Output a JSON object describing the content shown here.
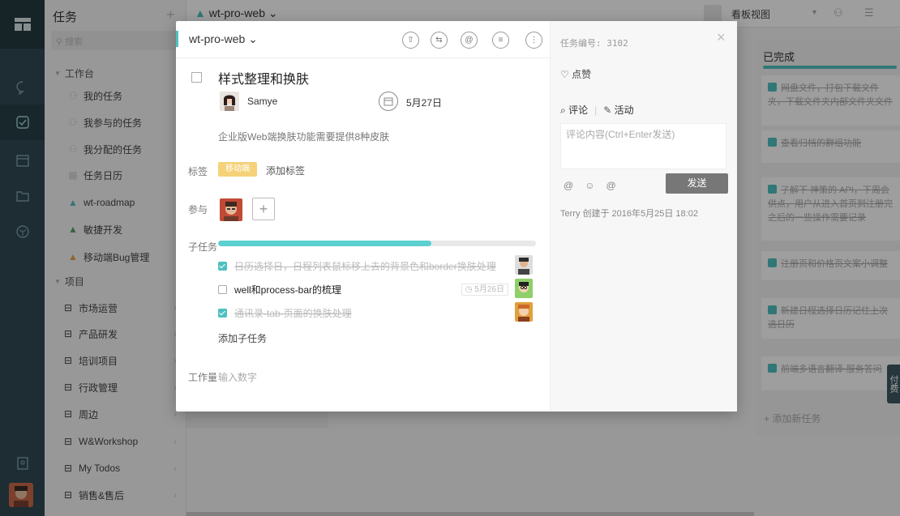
{
  "app": {
    "sidebar": {
      "title": "任务",
      "search_placeholder": "搜索",
      "groups": [
        {
          "label": "工作台"
        },
        {
          "label": "项目"
        }
      ],
      "workbench_items": [
        {
          "label": "我的任务"
        },
        {
          "label": "我参与的任务"
        },
        {
          "label": "我分配的任务"
        },
        {
          "label": "任务日历"
        },
        {
          "label": "wt-roadmap"
        },
        {
          "label": "敏捷开发"
        },
        {
          "label": "移动端Bug管理"
        }
      ],
      "project_items": [
        {
          "label": "市场运营"
        },
        {
          "label": "产品研发"
        },
        {
          "label": "培训项目"
        },
        {
          "label": "行政管理"
        },
        {
          "label": "周边"
        },
        {
          "label": "W&Workshop"
        },
        {
          "label": "My Todos"
        },
        {
          "label": "销售&售后"
        }
      ]
    },
    "topbar": {
      "project": "wt-pro-web",
      "view": "看板视图"
    },
    "done_column": {
      "title": "已完成",
      "cards": [
        {
          "text": "网盘文件，打包下载文件夹，下载文件夹内部文件夹文件"
        },
        {
          "text": "查看归档的群组功能"
        },
        {
          "text": "了解下 神策的 API，下周会供点，用户从进入首页到注册完之后的一些操作需要记录"
        },
        {
          "text": "注册页和价格页文案小调整"
        },
        {
          "text": "新建日程选择日历记住上次选日历"
        },
        {
          "text": "前端多语言翻译-服务答问"
        }
      ],
      "add_task": "+ 添加新任务"
    },
    "pay_button": "付费"
  },
  "modal": {
    "project": "wt-pro-web ⌄",
    "task": {
      "title": "样式整理和换肤",
      "assignee": "Samye",
      "due": "5月27日",
      "description": "企业版Web端换肤功能需要提供8种皮肤",
      "tags_label": "标签",
      "tag": "移动端",
      "add_tag": "添加标签",
      "participants_label": "参与",
      "subtasks_label": "子任务",
      "subtasks_progress": 0.67,
      "subtasks": [
        {
          "text": "日历选择日，日程列表鼠标移上去的背景色和border换肤处理",
          "done": true,
          "date": ""
        },
        {
          "text": "well和process-bar的梳理",
          "done": false,
          "date": "◷ 5月26日"
        },
        {
          "text": "通讯录-tab-页面的换肤处理",
          "done": true,
          "date": ""
        }
      ],
      "add_subtask": "添加子任务",
      "workload_label": "工作量",
      "workload_placeholder": "输入数字"
    },
    "side": {
      "task_id": "任务编号: 3102",
      "like": "♡ 点赞",
      "comment_tab": "评论",
      "activity_tab": "活动",
      "comment_placeholder": "评论内容(Ctrl+Enter发送)",
      "send": "发送",
      "activity": "Terry  创建于 2016年5月25日 18:02"
    }
  },
  "colors": {
    "accent": "#4fc0c0",
    "rail": "#2f4a53",
    "tag": "#f5d27a"
  }
}
